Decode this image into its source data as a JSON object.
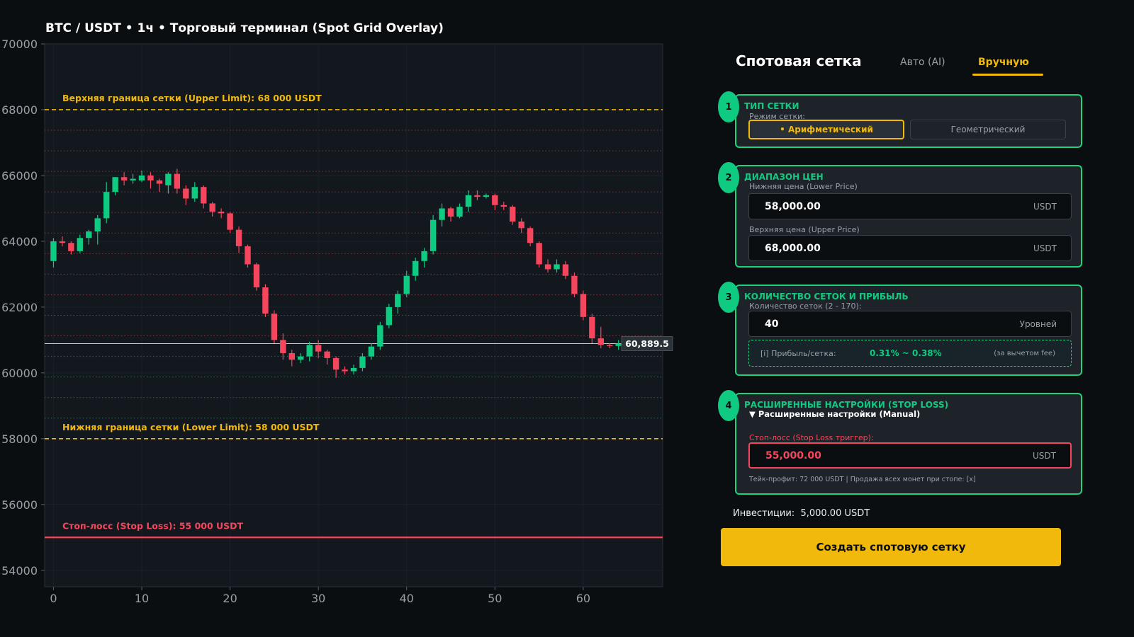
{
  "chart": {
    "title": "BTC / USDT • 1ч • Торговый терминал (Spot Grid Overlay)",
    "upper_label": "Верхняя граница сетки (Upper Limit): 68 000 USDT",
    "lower_label": "Нижняя граница сетки (Lower Limit): 58 000 USDT",
    "stop_label": "Стоп-лосс (Stop Loss): 55 000 USDT",
    "current_price_label": "60,889.5"
  },
  "chart_data": {
    "type": "candlestick",
    "x_ticks": [
      0,
      10,
      20,
      30,
      40,
      50,
      60
    ],
    "y_ticks": [
      54000,
      56000,
      58000,
      60000,
      62000,
      64000,
      66000,
      68000,
      70000
    ],
    "xlim": [
      -1,
      69
    ],
    "ylim": [
      53500,
      70000
    ],
    "upper_limit": 68000,
    "lower_limit": 58000,
    "stop_loss": 55000,
    "current_price": 60889.5,
    "grid_levels": [
      58625,
      59250,
      59875,
      60500,
      61125,
      61750,
      62375,
      63000,
      63625,
      64250,
      64875,
      65500,
      66125,
      66750,
      67375
    ],
    "colors": {
      "up": "#0ecb81",
      "down": "#f6465d",
      "limit": "#f0b90b",
      "stop": "#f6465d"
    },
    "candles": [
      [
        63400,
        64000,
        64100,
        63200
      ],
      [
        64000,
        63950,
        64150,
        63850
      ],
      [
        63950,
        63700,
        64000,
        63600
      ],
      [
        63700,
        64100,
        64200,
        63650
      ],
      [
        64100,
        64300,
        64350,
        63900
      ],
      [
        64300,
        64700,
        64800,
        63900
      ],
      [
        64700,
        65500,
        65800,
        64550
      ],
      [
        65500,
        65950,
        65950,
        65400
      ],
      [
        65950,
        65850,
        66100,
        65700
      ],
      [
        65850,
        65900,
        66050,
        65750
      ],
      [
        65850,
        66000,
        66150,
        65800
      ],
      [
        66000,
        65850,
        66100,
        65600
      ],
      [
        65850,
        65750,
        65900,
        65500
      ],
      [
        65700,
        66050,
        66100,
        65450
      ],
      [
        66050,
        65600,
        66200,
        65450
      ],
      [
        65600,
        65300,
        65700,
        65100
      ],
      [
        65300,
        65650,
        65800,
        65200
      ],
      [
        65650,
        65150,
        65700,
        65000
      ],
      [
        65150,
        64900,
        65200,
        64750
      ],
      [
        64900,
        64850,
        65000,
        64700
      ],
      [
        64850,
        64350,
        64900,
        64250
      ],
      [
        64350,
        63850,
        64450,
        63650
      ],
      [
        63850,
        63300,
        63900,
        63200
      ],
      [
        63300,
        62600,
        63350,
        62500
      ],
      [
        62600,
        61800,
        62700,
        61700
      ],
      [
        61800,
        61000,
        61900,
        60900
      ],
      [
        61000,
        60600,
        61200,
        60400
      ],
      [
        60600,
        60400,
        60700,
        60200
      ],
      [
        60400,
        60500,
        60600,
        60300
      ],
      [
        60500,
        60850,
        60950,
        60350
      ],
      [
        60850,
        60650,
        61000,
        60450
      ],
      [
        60650,
        60450,
        60700,
        60250
      ],
      [
        60450,
        60100,
        60500,
        59850
      ],
      [
        60100,
        60050,
        60200,
        59950
      ],
      [
        60050,
        60150,
        60250,
        59950
      ],
      [
        60150,
        60500,
        60600,
        60050
      ],
      [
        60500,
        60800,
        60900,
        60400
      ],
      [
        60800,
        61450,
        61550,
        60700
      ],
      [
        61450,
        62000,
        62100,
        61350
      ],
      [
        62000,
        62400,
        62500,
        61800
      ],
      [
        62400,
        62950,
        63100,
        62300
      ],
      [
        62950,
        63400,
        63500,
        62800
      ],
      [
        63400,
        63700,
        63800,
        63200
      ],
      [
        63700,
        64650,
        64800,
        63600
      ],
      [
        64650,
        65000,
        65150,
        64450
      ],
      [
        65000,
        64750,
        65050,
        64600
      ],
      [
        64750,
        65050,
        65150,
        64700
      ],
      [
        65050,
        65400,
        65550,
        64900
      ],
      [
        65400,
        65350,
        65550,
        65250
      ],
      [
        65350,
        65400,
        65450,
        65300
      ],
      [
        65400,
        65100,
        65450,
        64950
      ],
      [
        65100,
        65050,
        65200,
        64950
      ],
      [
        65050,
        64600,
        65100,
        64500
      ],
      [
        64600,
        64400,
        64700,
        64250
      ],
      [
        64400,
        63950,
        64450,
        63850
      ],
      [
        63950,
        63300,
        64000,
        63200
      ],
      [
        63300,
        63150,
        63450,
        63050
      ],
      [
        63150,
        63300,
        63450,
        63050
      ],
      [
        63300,
        62950,
        63400,
        62850
      ],
      [
        62950,
        62400,
        63050,
        62300
      ],
      [
        62400,
        61700,
        62500,
        61600
      ],
      [
        61700,
        61050,
        61800,
        60900
      ],
      [
        61050,
        60850,
        61400,
        60750
      ],
      [
        60850,
        60820,
        60900,
        60750
      ],
      [
        60820,
        60889.5,
        61000,
        60700
      ]
    ]
  },
  "panel": {
    "title": "Спотовая сетка",
    "tabs": {
      "auto": "Авто (AI)",
      "manual": "Вручную"
    },
    "card1": {
      "step": "1",
      "title": "ТИП СЕТКИ",
      "mode_label": "Режим сетки:",
      "options": {
        "arithmetic": "• Арифметический",
        "geometric": "Геометрический"
      }
    },
    "card2": {
      "step": "2",
      "title": "ДИАПАЗОН ЦЕН",
      "lower_label": "Нижняя цена (Lower Price)",
      "lower_value": "58,000.00",
      "upper_label": "Верхняя цена (Upper Price)",
      "upper_value": "68,000.00",
      "unit": "USDT"
    },
    "card3": {
      "step": "3",
      "title": "КОЛИЧЕСТВО СЕТОК И ПРИБЫЛЬ",
      "count_label": "Количество сеток (2 - 170):",
      "count_value": "40",
      "count_unit": "Уровней",
      "profit_label": "[i] Прибыль/сетка:",
      "profit_value": "0.31% ~ 0.38%",
      "profit_note": "(за вычетом fee)"
    },
    "card4": {
      "step": "4",
      "title": "РАСШИРЕННЫЕ НАСТРОЙКИ (STOP LOSS)",
      "toggle": "▼ Расширенные настройки (Manual)",
      "sl_label": "Стоп-лосс (Stop Loss триггер):",
      "sl_value": "55,000.00",
      "unit": "USDT",
      "note": "Тейк-профит: 72 000 USDT | Продажа всех монет при стопе: [x]"
    },
    "invest_label": "Инвестиции:",
    "invest_value": "5,000.00 USDT",
    "create_button": "Создать спотовую сетку"
  }
}
